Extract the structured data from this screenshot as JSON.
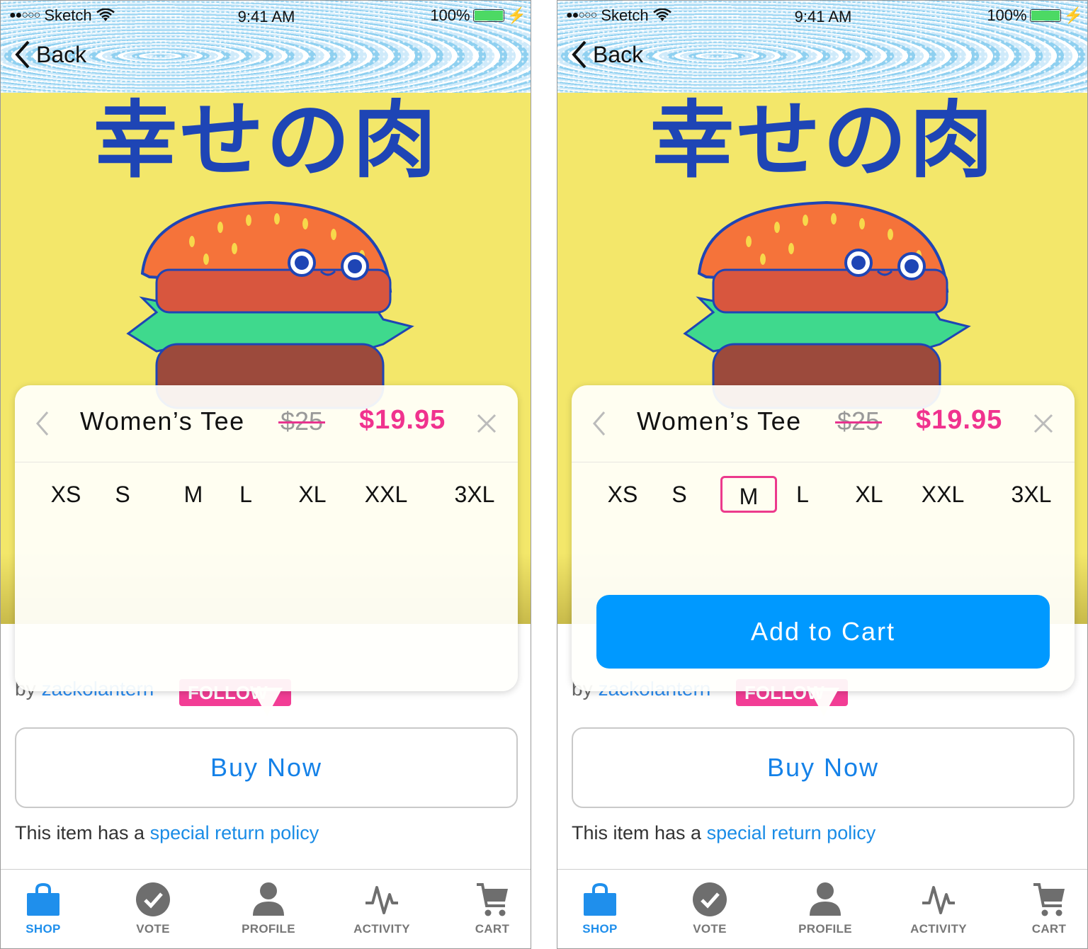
{
  "screens": [
    {
      "status": {
        "carrier": "Sketch",
        "time": "9:41 AM",
        "battery": "100%"
      },
      "nav": {
        "back_label": "Back"
      },
      "hero": {
        "jp_title": "幸せの肉"
      },
      "popover": {
        "title": "Women’s Tee",
        "old_price": "$25",
        "price": "$19.95",
        "sizes": [
          "XS",
          "S",
          "M",
          "L",
          "XL",
          "XXL",
          "3XL"
        ],
        "selected_size": "",
        "add_to_cart_label": ""
      },
      "byline": {
        "prefix": "by",
        "username": "zackolantern",
        "follow_label": "FOLLOW"
      },
      "buy_now_label": "Buy Now",
      "policy": {
        "prefix": "This item has a",
        "link": "special return policy"
      },
      "tabs": [
        {
          "label": "SHOP",
          "icon": "shop-bag-icon",
          "active": true
        },
        {
          "label": "VOTE",
          "icon": "check-circle-icon",
          "active": false
        },
        {
          "label": "PROFILE",
          "icon": "person-icon",
          "active": false
        },
        {
          "label": "ACTIVITY",
          "icon": "activity-icon",
          "active": false
        },
        {
          "label": "CART",
          "icon": "cart-icon",
          "active": false
        }
      ]
    },
    {
      "status": {
        "carrier": "Sketch",
        "time": "9:41 AM",
        "battery": "100%"
      },
      "nav": {
        "back_label": "Back"
      },
      "hero": {
        "jp_title": "幸せの肉"
      },
      "popover": {
        "title": "Women’s Tee",
        "old_price": "$25",
        "price": "$19.95",
        "sizes": [
          "XS",
          "S",
          "M",
          "L",
          "XL",
          "XXL",
          "3XL"
        ],
        "selected_size": "M",
        "add_to_cart_label": "Add to Cart"
      },
      "byline": {
        "prefix": "by",
        "username": "zackolantern",
        "follow_label": "FOLLOW"
      },
      "buy_now_label": "Buy Now",
      "policy": {
        "prefix": "This item has a",
        "link": "special return policy"
      },
      "tabs": [
        {
          "label": "SHOP",
          "icon": "shop-bag-icon",
          "active": true
        },
        {
          "label": "VOTE",
          "icon": "check-circle-icon",
          "active": false
        },
        {
          "label": "PROFILE",
          "icon": "person-icon",
          "active": false
        },
        {
          "label": "ACTIVITY",
          "icon": "activity-icon",
          "active": false
        },
        {
          "label": "CART",
          "icon": "cart-icon",
          "active": false
        }
      ]
    }
  ],
  "colors": {
    "accent_pink": "#f0328e",
    "link_blue": "#1a8ce6",
    "cta_blue": "#0099ff",
    "hero_yellow": "#f3e76a"
  }
}
